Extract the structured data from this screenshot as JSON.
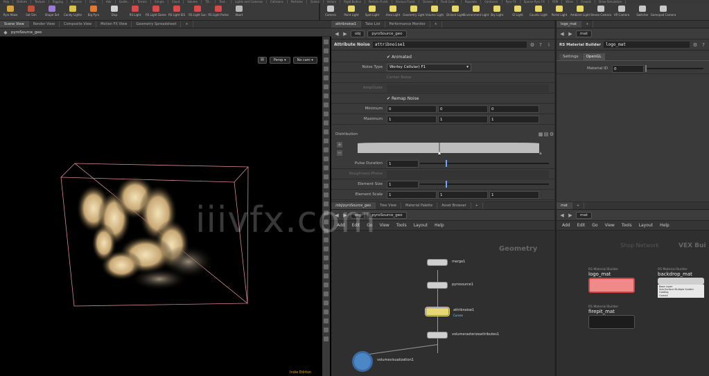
{
  "shelf_tabs_top": [
    "Poly",
    "Deform",
    "Texture",
    "Rigging",
    "Muscles",
    "Char...",
    "Hair",
    "Guide...",
    "Terrain",
    "Simple",
    "Cloud",
    "Volume",
    "TD...",
    "Test...",
    "Lights and Cameras",
    "Collisions",
    "Particles",
    "Grains",
    "Vellum",
    "Rigid Bodies",
    "Particle Fluids",
    "Viscous Fluids",
    "Oceans",
    "Fluid Cont...",
    "Populate",
    "Container",
    "Pyro FX",
    "Sparse Pyro FX",
    "FEM",
    "Wires",
    "Crowds",
    "Drive Simulation"
  ],
  "left_tools": [
    {
      "label": "Pyro Make",
      "color": "#d9a23a"
    },
    {
      "label": "Set Sim",
      "color": "#c0503a"
    },
    {
      "label": "Shape Set",
      "color": "#9a7bd8"
    },
    {
      "label": "Candy Lights",
      "color": "#d8c24a"
    },
    {
      "label": "Big Pyro",
      "color": "#e07a30"
    },
    {
      "label": "Disp",
      "color": "#d2d2d2"
    },
    {
      "label": "RS Light",
      "color": "#d84a4a"
    },
    {
      "label": "RS Light Dome",
      "color": "#d84a4a"
    },
    {
      "label": "RS Light IES",
      "color": "#d84a4a"
    },
    {
      "label": "RS Light Sun",
      "color": "#d84a4a"
    },
    {
      "label": "RS Light Portal",
      "color": "#d84a4a"
    },
    {
      "label": "Abort",
      "color": "#b8b8b8"
    }
  ],
  "right_tools": [
    {
      "label": "Camera",
      "color": "#c8c8c8"
    },
    {
      "label": "Point Light",
      "color": "#e8d86a"
    },
    {
      "label": "Spot Light",
      "color": "#e8d86a"
    },
    {
      "label": "Area Light",
      "color": "#e8d86a"
    },
    {
      "label": "Geometry Light",
      "color": "#e8d86a"
    },
    {
      "label": "Volume Light",
      "color": "#e8d86a"
    },
    {
      "label": "Distant Light",
      "color": "#e8d86a"
    },
    {
      "label": "Environment Light",
      "color": "#e8d86a"
    },
    {
      "label": "Sky Light",
      "color": "#e8d86a"
    },
    {
      "label": "GI Light",
      "color": "#e8d86a"
    },
    {
      "label": "Caustic Light",
      "color": "#e8d86a"
    },
    {
      "label": "Portal Light",
      "color": "#e8d86a"
    },
    {
      "label": "Ambient Light",
      "color": "#e8d86a"
    },
    {
      "label": "Stereo Camera",
      "color": "#c8c8c8"
    },
    {
      "label": "VR Camera",
      "color": "#c8c8c8"
    },
    {
      "label": "Switcher",
      "color": "#c8c8c8"
    },
    {
      "label": "Gamepad Camera",
      "color": "#c8c8c8"
    }
  ],
  "viewport": {
    "tabs": [
      "Scene View",
      "Render View",
      "Composite View",
      "Motion FX View",
      "Geometry Spreadsheet"
    ],
    "path": "pyroSource_geo",
    "persp": "Persp ▾",
    "cam": "No cam ▾",
    "footer": "Indie Edition"
  },
  "params": {
    "tabs": [
      "attribnoise1",
      "Take List",
      "Performance Monitor"
    ],
    "path": "obj",
    "node_path": "pyroSource_geo",
    "node_type": "Attribute Noise",
    "node_name": "attribnoise1",
    "animated_label": "Animated",
    "noise_type_label": "Noise Type",
    "noise_type_value": "Worley Cellular) F1",
    "center_noise": "Center Noise",
    "amplitude": "Amplitude",
    "remap_label": "Remap Noise",
    "minimum_label": "Minimum",
    "maximum_label": "Maximum",
    "min_values": [
      "0",
      "0",
      "0"
    ],
    "max_values": [
      "1",
      "1",
      "1"
    ],
    "distribution_label": "Distribution",
    "pulse_duration_label": "Pulse Duration",
    "pulse_duration_value": "1",
    "pulse_duration_level": 0.2,
    "roughness_label": "Roughness Phase",
    "element_size_label": "Element Size",
    "element_size_value": "1",
    "element_size_level": 0.2,
    "element_scale_label": "Element Scale",
    "element_scale_values": [
      "1",
      "1",
      "1"
    ]
  },
  "material": {
    "tab": "logo_mat",
    "path": "mat",
    "type": "RS Material Builder",
    "name": "logo_mat",
    "subtabs": [
      "Settings",
      "OpenGL"
    ],
    "id_label": "Material ID",
    "id_value": "0"
  },
  "network": {
    "tabs": [
      "/obj/pyroSource_geo",
      "Tree View",
      "Material Palette",
      "Asset Browser"
    ],
    "path1": "obj",
    "path2": "pyroSource_geo",
    "menus": [
      "Add",
      "Edit",
      "Go",
      "View",
      "Tools",
      "Layout",
      "Help"
    ],
    "context": "Geometry",
    "nodes": [
      {
        "name": "merge1",
        "sub": "",
        "color": "#cfcfcf"
      },
      {
        "name": "pyrosource1",
        "sub": "",
        "color": "#cfcfcf"
      },
      {
        "name": "attribnoise1",
        "sub": "Curves",
        "color": "#e8d874"
      },
      {
        "name": "volumerasterizeattributes1",
        "sub": "",
        "color": "#cfcfcf"
      },
      {
        "name": "volumevisualization1",
        "sub": "",
        "color": "#4b86c7"
      }
    ]
  },
  "matnet": {
    "tabs": [
      "mat"
    ],
    "path": "mat",
    "menus": [
      "Add",
      "Edit",
      "Go",
      "View",
      "Tools",
      "Layout",
      "Help"
    ],
    "context1": "Shop Network",
    "context2": "VEX Bui",
    "nodes": [
      {
        "cat": "RS Material Builder",
        "name": "logo_mat",
        "color": "#f08a8a"
      },
      {
        "cat": "RS Material Builder",
        "name": "backdrop_mat",
        "color": "#cfcfcf"
      },
      {
        "cat": "RS Material Builder",
        "name": "firepit_mat",
        "color": "#1c1c1c"
      }
    ],
    "backdrop_lines": [
      "Base Layer",
      "Sub-Surface Multiple Scatter",
      "Coating",
      "Overall"
    ]
  },
  "watermark": "iiivfx.com"
}
